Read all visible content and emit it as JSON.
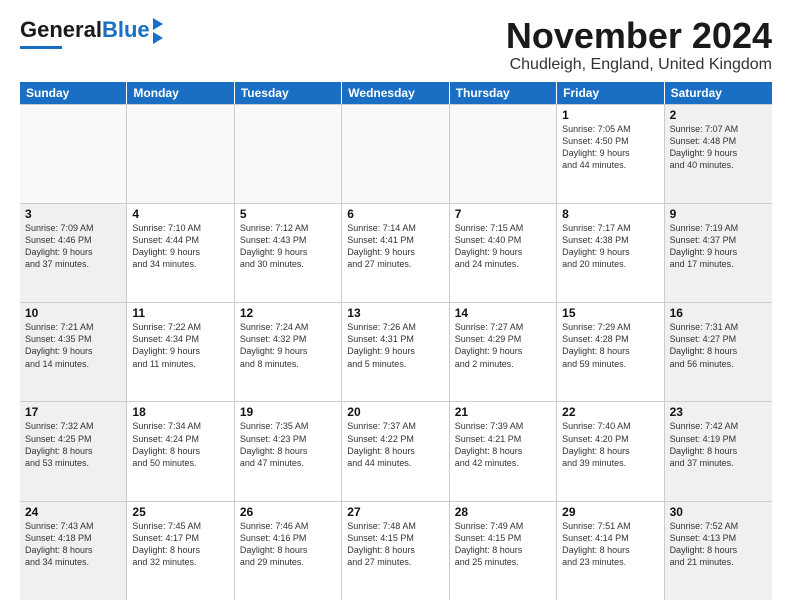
{
  "logo": {
    "general": "General",
    "blue": "Blue"
  },
  "header": {
    "month_year": "November 2024",
    "location": "Chudleigh, England, United Kingdom"
  },
  "weekdays": [
    "Sunday",
    "Monday",
    "Tuesday",
    "Wednesday",
    "Thursday",
    "Friday",
    "Saturday"
  ],
  "weeks": [
    [
      {
        "day": "",
        "info": "",
        "empty": true
      },
      {
        "day": "",
        "info": "",
        "empty": true
      },
      {
        "day": "",
        "info": "",
        "empty": true
      },
      {
        "day": "",
        "info": "",
        "empty": true
      },
      {
        "day": "",
        "info": "",
        "empty": true
      },
      {
        "day": "1",
        "info": "Sunrise: 7:05 AM\nSunset: 4:50 PM\nDaylight: 9 hours\nand 44 minutes.",
        "empty": false
      },
      {
        "day": "2",
        "info": "Sunrise: 7:07 AM\nSunset: 4:48 PM\nDaylight: 9 hours\nand 40 minutes.",
        "empty": false,
        "shaded": true
      }
    ],
    [
      {
        "day": "3",
        "info": "Sunrise: 7:09 AM\nSunset: 4:46 PM\nDaylight: 9 hours\nand 37 minutes.",
        "empty": false,
        "shaded": true
      },
      {
        "day": "4",
        "info": "Sunrise: 7:10 AM\nSunset: 4:44 PM\nDaylight: 9 hours\nand 34 minutes.",
        "empty": false
      },
      {
        "day": "5",
        "info": "Sunrise: 7:12 AM\nSunset: 4:43 PM\nDaylight: 9 hours\nand 30 minutes.",
        "empty": false
      },
      {
        "day": "6",
        "info": "Sunrise: 7:14 AM\nSunset: 4:41 PM\nDaylight: 9 hours\nand 27 minutes.",
        "empty": false
      },
      {
        "day": "7",
        "info": "Sunrise: 7:15 AM\nSunset: 4:40 PM\nDaylight: 9 hours\nand 24 minutes.",
        "empty": false
      },
      {
        "day": "8",
        "info": "Sunrise: 7:17 AM\nSunset: 4:38 PM\nDaylight: 9 hours\nand 20 minutes.",
        "empty": false
      },
      {
        "day": "9",
        "info": "Sunrise: 7:19 AM\nSunset: 4:37 PM\nDaylight: 9 hours\nand 17 minutes.",
        "empty": false,
        "shaded": true
      }
    ],
    [
      {
        "day": "10",
        "info": "Sunrise: 7:21 AM\nSunset: 4:35 PM\nDaylight: 9 hours\nand 14 minutes.",
        "empty": false,
        "shaded": true
      },
      {
        "day": "11",
        "info": "Sunrise: 7:22 AM\nSunset: 4:34 PM\nDaylight: 9 hours\nand 11 minutes.",
        "empty": false
      },
      {
        "day": "12",
        "info": "Sunrise: 7:24 AM\nSunset: 4:32 PM\nDaylight: 9 hours\nand 8 minutes.",
        "empty": false
      },
      {
        "day": "13",
        "info": "Sunrise: 7:26 AM\nSunset: 4:31 PM\nDaylight: 9 hours\nand 5 minutes.",
        "empty": false
      },
      {
        "day": "14",
        "info": "Sunrise: 7:27 AM\nSunset: 4:29 PM\nDaylight: 9 hours\nand 2 minutes.",
        "empty": false
      },
      {
        "day": "15",
        "info": "Sunrise: 7:29 AM\nSunset: 4:28 PM\nDaylight: 8 hours\nand 59 minutes.",
        "empty": false
      },
      {
        "day": "16",
        "info": "Sunrise: 7:31 AM\nSunset: 4:27 PM\nDaylight: 8 hours\nand 56 minutes.",
        "empty": false,
        "shaded": true
      }
    ],
    [
      {
        "day": "17",
        "info": "Sunrise: 7:32 AM\nSunset: 4:25 PM\nDaylight: 8 hours\nand 53 minutes.",
        "empty": false,
        "shaded": true
      },
      {
        "day": "18",
        "info": "Sunrise: 7:34 AM\nSunset: 4:24 PM\nDaylight: 8 hours\nand 50 minutes.",
        "empty": false
      },
      {
        "day": "19",
        "info": "Sunrise: 7:35 AM\nSunset: 4:23 PM\nDaylight: 8 hours\nand 47 minutes.",
        "empty": false
      },
      {
        "day": "20",
        "info": "Sunrise: 7:37 AM\nSunset: 4:22 PM\nDaylight: 8 hours\nand 44 minutes.",
        "empty": false
      },
      {
        "day": "21",
        "info": "Sunrise: 7:39 AM\nSunset: 4:21 PM\nDaylight: 8 hours\nand 42 minutes.",
        "empty": false
      },
      {
        "day": "22",
        "info": "Sunrise: 7:40 AM\nSunset: 4:20 PM\nDaylight: 8 hours\nand 39 minutes.",
        "empty": false
      },
      {
        "day": "23",
        "info": "Sunrise: 7:42 AM\nSunset: 4:19 PM\nDaylight: 8 hours\nand 37 minutes.",
        "empty": false,
        "shaded": true
      }
    ],
    [
      {
        "day": "24",
        "info": "Sunrise: 7:43 AM\nSunset: 4:18 PM\nDaylight: 8 hours\nand 34 minutes.",
        "empty": false,
        "shaded": true
      },
      {
        "day": "25",
        "info": "Sunrise: 7:45 AM\nSunset: 4:17 PM\nDaylight: 8 hours\nand 32 minutes.",
        "empty": false
      },
      {
        "day": "26",
        "info": "Sunrise: 7:46 AM\nSunset: 4:16 PM\nDaylight: 8 hours\nand 29 minutes.",
        "empty": false
      },
      {
        "day": "27",
        "info": "Sunrise: 7:48 AM\nSunset: 4:15 PM\nDaylight: 8 hours\nand 27 minutes.",
        "empty": false
      },
      {
        "day": "28",
        "info": "Sunrise: 7:49 AM\nSunset: 4:15 PM\nDaylight: 8 hours\nand 25 minutes.",
        "empty": false
      },
      {
        "day": "29",
        "info": "Sunrise: 7:51 AM\nSunset: 4:14 PM\nDaylight: 8 hours\nand 23 minutes.",
        "empty": false
      },
      {
        "day": "30",
        "info": "Sunrise: 7:52 AM\nSunset: 4:13 PM\nDaylight: 8 hours\nand 21 minutes.",
        "empty": false,
        "shaded": true
      }
    ]
  ]
}
